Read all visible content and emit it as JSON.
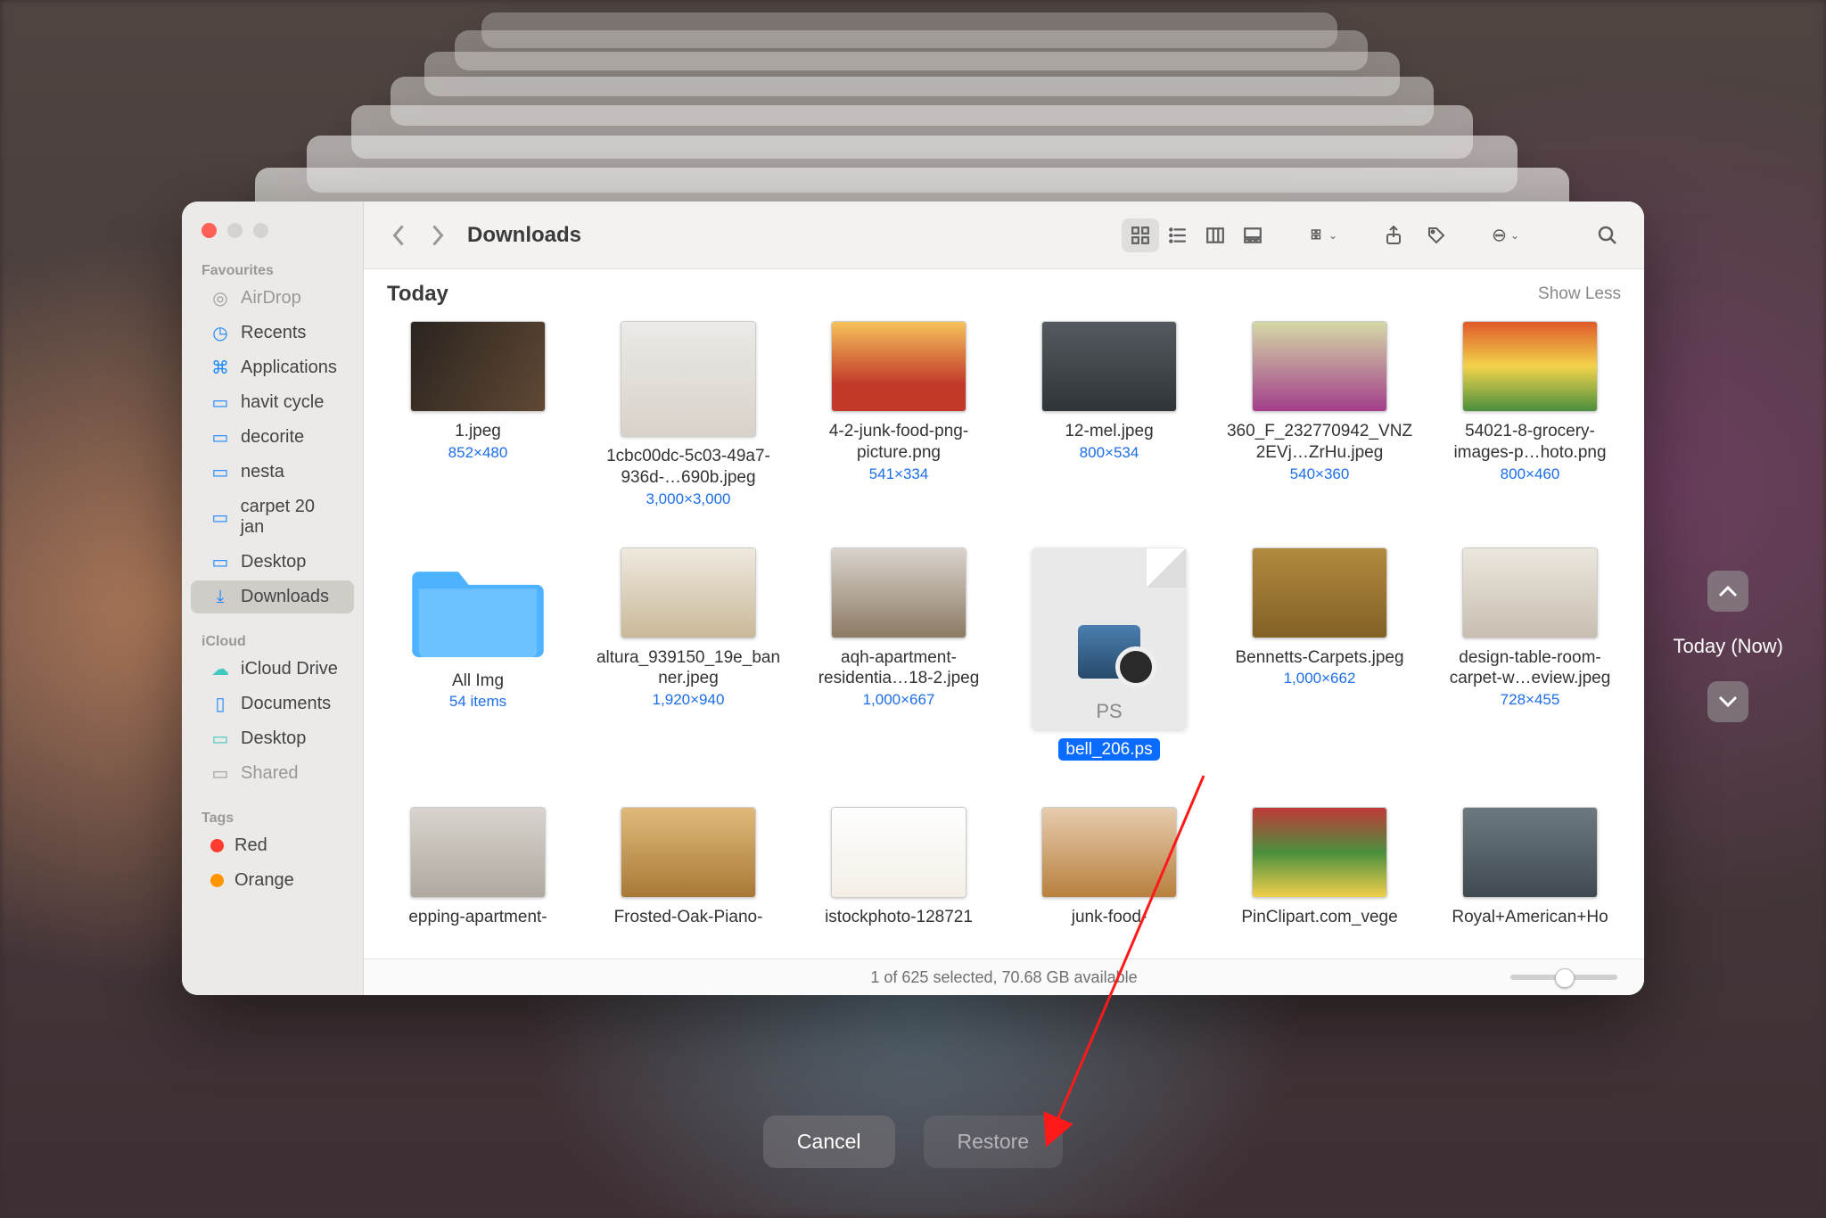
{
  "window": {
    "title": "Downloads"
  },
  "sidebar": {
    "favourites_header": "Favourites",
    "icloud_header": "iCloud",
    "tags_header": "Tags",
    "items": [
      {
        "label": "AirDrop",
        "icon": "airdrop",
        "dim": true
      },
      {
        "label": "Recents",
        "icon": "clock"
      },
      {
        "label": "Applications",
        "icon": "app"
      },
      {
        "label": "havit cycle",
        "icon": "folder"
      },
      {
        "label": "decorite",
        "icon": "folder"
      },
      {
        "label": "nesta",
        "icon": "folder"
      },
      {
        "label": "carpet 20 jan",
        "icon": "folder"
      },
      {
        "label": "Desktop",
        "icon": "folder"
      },
      {
        "label": "Downloads",
        "icon": "download",
        "active": true
      }
    ],
    "icloud": [
      {
        "label": "iCloud Drive",
        "icon": "cloud"
      },
      {
        "label": "Documents",
        "icon": "doc"
      },
      {
        "label": "Desktop",
        "icon": "desktop"
      },
      {
        "label": "Shared",
        "icon": "shared",
        "dim": true
      }
    ],
    "tags": [
      {
        "label": "Red",
        "color": "#ff3b30"
      },
      {
        "label": "Orange",
        "color": "#ff9500"
      }
    ]
  },
  "section": {
    "title": "Today",
    "toggle": "Show Less"
  },
  "files": {
    "r1": [
      {
        "name": "1.jpeg",
        "meta": "852×480"
      },
      {
        "name": "1cbc00dc-5c03-49a7-936d-…690b.jpeg",
        "meta": "3,000×3,000"
      },
      {
        "name": "4-2-junk-food-png-picture.png",
        "meta": "541×334"
      },
      {
        "name": "12-mel.jpeg",
        "meta": "800×534"
      },
      {
        "name": "360_F_232770942_VNZ2EVj…ZrHu.jpeg",
        "meta": "540×360"
      },
      {
        "name": "54021-8-grocery-images-p…hoto.png",
        "meta": "800×460"
      }
    ],
    "r2": [
      {
        "name": "All Img",
        "meta": "54 items",
        "folder": true
      },
      {
        "name": "altura_939150_19e_banner.jpeg",
        "meta": "1,920×940"
      },
      {
        "name": "aqh-apartment-residentia…18-2.jpeg",
        "meta": "1,000×667"
      },
      {
        "name": "bell_206.ps",
        "meta": "",
        "selected": true,
        "ps": true,
        "ps_label": "PS"
      },
      {
        "name": "Bennetts-Carpets.jpeg",
        "meta": "1,000×662"
      },
      {
        "name": "design-table-room-carpet-w…eview.jpeg",
        "meta": "728×455"
      }
    ],
    "r3": [
      {
        "name": "epping-apartment-"
      },
      {
        "name": "Frosted-Oak-Piano-"
      },
      {
        "name": "istockphoto-128721"
      },
      {
        "name": "junk-food-"
      },
      {
        "name": "PinClipart.com_vege"
      },
      {
        "name": "Royal+American+Ho"
      }
    ]
  },
  "status": "1 of 625 selected, 70.68 GB available",
  "footer": {
    "cancel": "Cancel",
    "restore": "Restore"
  },
  "timeline": {
    "label": "Today (Now)"
  }
}
